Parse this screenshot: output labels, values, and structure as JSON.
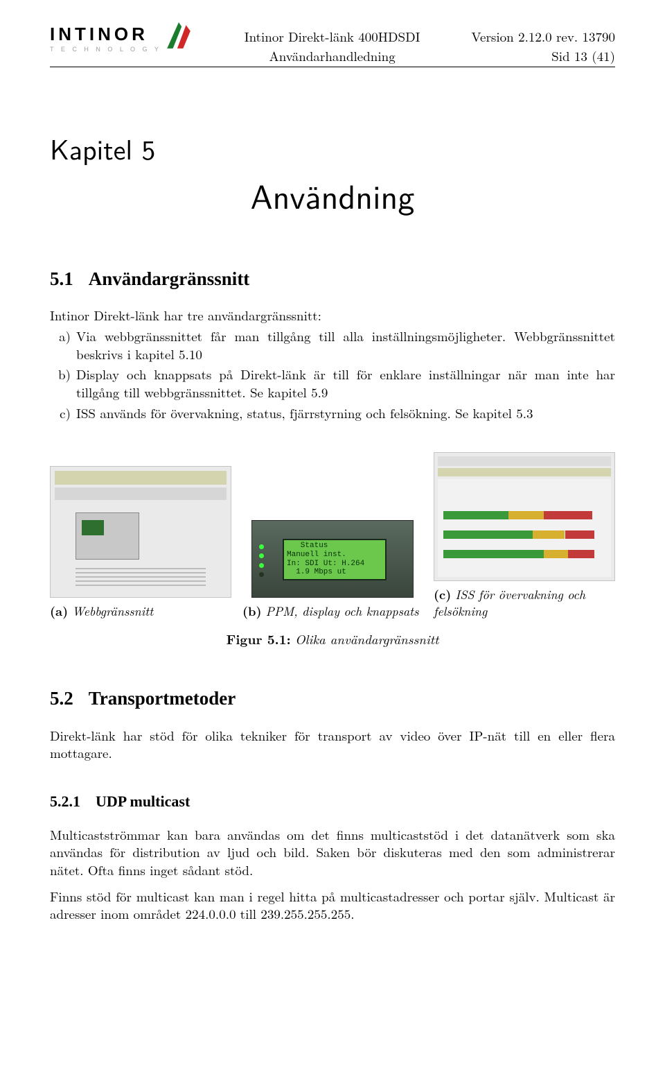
{
  "header": {
    "logo_word": "INTINOR",
    "logo_sub": "T E C H N O L O G Y",
    "center_line1": "Intinor Direkt-länk 400HDSDI",
    "center_line2": "Användarhandledning",
    "right_line1": "Version 2.12.0 rev. 13790",
    "right_line2": "Sid 13 (41)"
  },
  "chapter": {
    "label": "Kapitel 5",
    "title": "Användning"
  },
  "section_51": {
    "heading_num": "5.1",
    "heading_text": "Användargränssnitt",
    "intro": "Intinor Direkt-länk har tre användargränssnitt:",
    "items": [
      {
        "mark": "a)",
        "text": "Via webbgränssnittet får man tillgång till alla inställningsmöjligheter. Webbgränssnittet beskrivs i kapitel 5.10"
      },
      {
        "mark": "b)",
        "text": "Display och knappsats på Direkt-länk är till för enklare inställningar när man inte har tillgång till webbgränssnittet. Se kapitel 5.9"
      },
      {
        "mark": "c)",
        "text": "ISS används för övervakning, status, fjärrstyrning och felsökning. Se kapitel 5.3"
      }
    ]
  },
  "figure": {
    "lcd_text": "   Status\nManuell inst.\nIn: SDI Ut: H.264\n  1.9 Mbps ut",
    "subs": [
      {
        "label": "(a)",
        "text": "Webbgränssnitt"
      },
      {
        "label": "(b)",
        "text": "PPM, display och knappsats"
      },
      {
        "label": "(c)",
        "text_lead": "ISS för övervakning och",
        "text_trail": "felsökning"
      }
    ],
    "master_label": "Figur 5.1:",
    "master_text": "Olika användargränssnitt"
  },
  "section_52": {
    "heading_num": "5.2",
    "heading_text": "Transportmetoder",
    "para": "Direkt-länk har stöd för olika tekniker för transport av video över IP-nät till en eller flera mottagare."
  },
  "section_521": {
    "heading_num": "5.2.1",
    "heading_text": "UDP multicast",
    "para1": "Multicastströmmar kan bara användas om det finns multicaststöd i det datanätverk som ska användas för distribution av ljud och bild. Saken bör diskuteras med den som administrerar nätet. Ofta finns inget sådant stöd.",
    "para2": "Finns stöd för multicast kan man i regel hitta på multicastadresser och portar själv. Multicast är adresser inom området 224.0.0.0 till 239.255.255.255."
  }
}
